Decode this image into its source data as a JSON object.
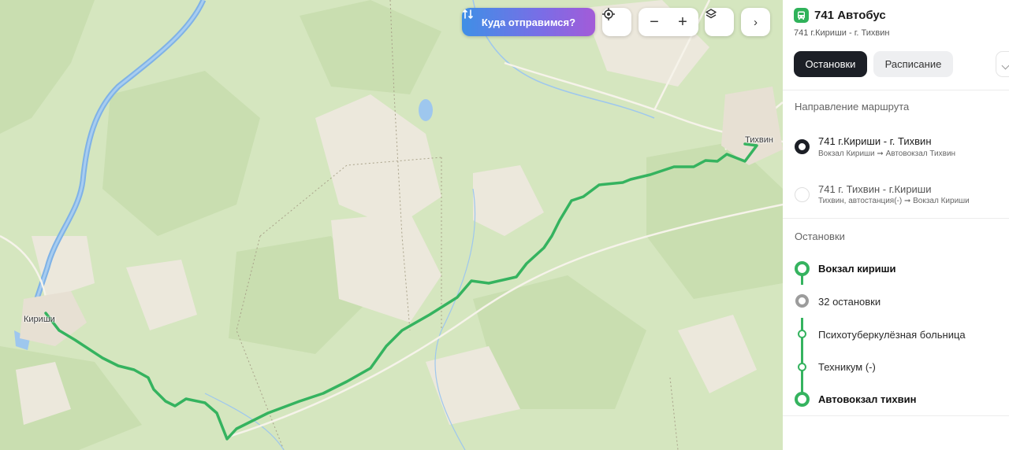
{
  "map": {
    "cities": [
      {
        "name": "Кириши"
      },
      {
        "name": "Тихвин"
      }
    ],
    "toolbar": {
      "where_label": "Куда отправимся?",
      "zoom_out": "−",
      "zoom_in": "+",
      "next": "›"
    },
    "route_color": "#35b35f"
  },
  "panel": {
    "route_title": "741 Автобус",
    "route_subtitle": "741 г.Кириши - г. Тихвин",
    "tabs": [
      {
        "label": "Остановки",
        "active": true
      },
      {
        "label": "Расписание",
        "active": false
      }
    ],
    "direction_section": "Направление маршрута",
    "directions": [
      {
        "title": "741 г.Кириши - г. Тихвин",
        "subtitle": "Вокзал Кириши ➞ Автовокзал Тихвин",
        "selected": true
      },
      {
        "title": "741 г. Тихвин - г.Кириши",
        "subtitle": "Тихвин, автостанция(-) ➞ Вокзал Кириши",
        "selected": false
      }
    ],
    "stops_section": "Остановки",
    "stops": [
      {
        "name": "Вокзал кириши"
      },
      {
        "name": "32 остановки"
      },
      {
        "name": "Психотуберкулёзная больница"
      },
      {
        "name": "Техникум (-)"
      },
      {
        "name": "Автовокзал тихвин"
      }
    ]
  },
  "colors": {
    "accent_green": "#35b35f",
    "dark_tab": "#1c1f26",
    "gradient_start": "#3f8fe6",
    "gradient_end": "#a35bd8"
  }
}
